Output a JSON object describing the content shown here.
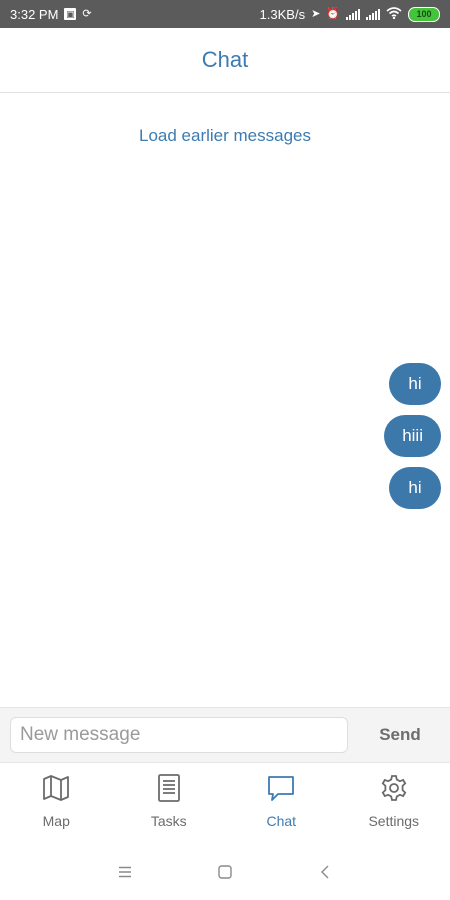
{
  "status_bar": {
    "time": "3:32 PM",
    "network_speed": "1.3KB/s",
    "battery": "100",
    "icons": [
      "notification-icon",
      "sync-icon",
      "location-arrow-icon",
      "alarm-icon",
      "signal-icon",
      "signal-icon",
      "wifi-icon",
      "battery-icon"
    ]
  },
  "header": {
    "title": "Chat"
  },
  "messages_area": {
    "load_earlier": "Load earlier messages",
    "messages": [
      {
        "text": "hi",
        "sender": "me"
      },
      {
        "text": "hiii",
        "sender": "me"
      },
      {
        "text": "hi",
        "sender": "me"
      }
    ]
  },
  "composer": {
    "placeholder": "New message",
    "value": "",
    "send_label": "Send"
  },
  "tabbar": {
    "tabs": [
      {
        "label": "Map",
        "icon": "map-icon"
      },
      {
        "label": "Tasks",
        "icon": "document-icon"
      },
      {
        "label": "Chat",
        "icon": "chat-bubble-icon",
        "active": true
      },
      {
        "label": "Settings",
        "icon": "gear-icon"
      }
    ]
  },
  "system_nav": {
    "icons": [
      "menu-icon",
      "home-icon",
      "back-icon"
    ]
  },
  "colors": {
    "accent": "#3d7bb0",
    "bubble": "#3d78ab",
    "status_bar": "#5b5b5b"
  }
}
